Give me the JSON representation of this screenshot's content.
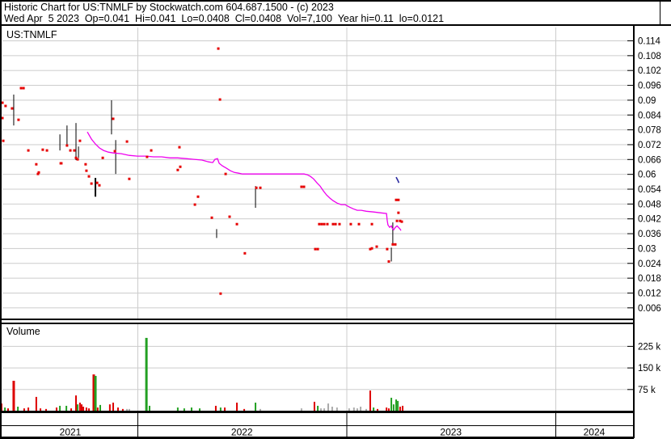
{
  "header": {
    "line1": "Historic Chart for US:TNMLF by Stockwatch.com 604.687.1500 - (c) 2023",
    "line2": "Wed Apr  5 2023  Op=0.041  Hi=0.041  Lo=0.0408  Cl=0.0408  Vol=7,100  Year hi=0.11  lo=0.0121"
  },
  "price_pane": {
    "title": "US:TNMLF"
  },
  "volume_pane": {
    "title": "Volume"
  },
  "colors": {
    "ma": "#ee00ee",
    "dot": "#e60000",
    "range_bar": "#000000",
    "vol_up": "#22a022",
    "vol_down": "#dd0000",
    "vol_flat": "#aaaaaa",
    "grid": "#cccccc",
    "marker": "#2a2aa0",
    "border": "#000000",
    "text": "#000000"
  },
  "chart_data": {
    "type": "line",
    "subtype": "stock-history-with-volume",
    "symbol": "US:TNMLF",
    "x_axis": {
      "years": [
        {
          "label": "2021",
          "start": 2021.358,
          "end": 2022.0
        },
        {
          "label": "2022",
          "start": 2022.0,
          "end": 2023.0
        },
        {
          "label": "2023",
          "start": 2023.0,
          "end": 2024.0
        },
        {
          "label": "2024",
          "start": 2024.0,
          "end": 2024.371
        }
      ],
      "t_min": 2021.358,
      "t_max": 2024.371,
      "year_boundaries": [
        2022,
        2023,
        2024
      ],
      "grid": true
    },
    "price_axis": {
      "tick_labels": [
        "0.114",
        "0.108",
        "0.102",
        "0.096",
        "0.09",
        "0.084",
        "0.078",
        "0.072",
        "0.066",
        "0.06",
        "0.054",
        "0.048",
        "0.042",
        "0.036",
        "0.03",
        "0.024",
        "0.018",
        "0.012",
        "0.006"
      ],
      "min": 0.006,
      "max": 0.114,
      "step": 0.006,
      "grid": true,
      "side": "right"
    },
    "volume_axis": {
      "ticks": [
        {
          "label": "225 k",
          "value": 225000
        },
        {
          "label": "150 k",
          "value": 150000
        },
        {
          "label": "75 k",
          "value": 75000
        }
      ],
      "grid": true,
      "side": "right"
    },
    "ma_line": {
      "name": "moving-average",
      "points": [
        [
          2021.76,
          0.077
        ],
        [
          2021.78,
          0.0741
        ],
        [
          2021.799,
          0.0721
        ],
        [
          2021.818,
          0.0705
        ],
        [
          2021.838,
          0.0695
        ],
        [
          2021.861,
          0.0688
        ],
        [
          2021.884,
          0.0685
        ],
        [
          2021.923,
          0.0682
        ],
        [
          2021.961,
          0.0675
        ],
        [
          2022.0,
          0.0672
        ],
        [
          2022.039,
          0.0672
        ],
        [
          2022.077,
          0.0669
        ],
        [
          2022.116,
          0.0669
        ],
        [
          2022.155,
          0.0665
        ],
        [
          2022.193,
          0.0665
        ],
        [
          2022.232,
          0.0662
        ],
        [
          2022.271,
          0.0659
        ],
        [
          2022.309,
          0.0656
        ],
        [
          2022.34,
          0.0649
        ],
        [
          2022.36,
          0.0646
        ],
        [
          2022.371,
          0.0659
        ],
        [
          2022.383,
          0.0662
        ],
        [
          2022.391,
          0.0643
        ],
        [
          2022.406,
          0.0633
        ],
        [
          2022.426,
          0.0623
        ],
        [
          2022.445,
          0.0613
        ],
        [
          2022.464,
          0.0606
        ],
        [
          2022.484,
          0.0603
        ],
        [
          2022.503,
          0.06
        ],
        [
          2022.797,
          0.06
        ],
        [
          2022.812,
          0.0597
        ],
        [
          2022.828,
          0.059
        ],
        [
          2022.843,
          0.058
        ],
        [
          2022.859,
          0.0564
        ],
        [
          2022.874,
          0.0551
        ],
        [
          2022.89,
          0.0531
        ],
        [
          2022.905,
          0.0515
        ],
        [
          2022.921,
          0.0502
        ],
        [
          2022.936,
          0.0492
        ],
        [
          2022.955,
          0.0482
        ],
        [
          2022.975,
          0.0476
        ],
        [
          2022.994,
          0.0476
        ],
        [
          2023.014,
          0.0466
        ],
        [
          2023.033,
          0.0459
        ],
        [
          2023.052,
          0.0453
        ],
        [
          2023.071,
          0.0453
        ],
        [
          2023.095,
          0.0449
        ],
        [
          2023.13,
          0.0446
        ],
        [
          2023.161,
          0.0443
        ],
        [
          2023.192,
          0.044
        ],
        [
          2023.195,
          0.0413
        ],
        [
          2023.199,
          0.0394
        ],
        [
          2023.207,
          0.0384
        ],
        [
          2023.215,
          0.039
        ],
        [
          2023.219,
          0.0381
        ],
        [
          2023.226,
          0.0374
        ],
        [
          2023.234,
          0.0384
        ],
        [
          2023.242,
          0.039
        ],
        [
          2023.249,
          0.0384
        ],
        [
          2023.257,
          0.0377
        ],
        [
          2023.261,
          0.0371
        ]
      ]
    },
    "trade_dots": {
      "name": "trade-price-dots",
      "points": [
        [
          2021.354,
          0.0888
        ],
        [
          2021.354,
          0.0826
        ],
        [
          2021.358,
          0.0734
        ],
        [
          2021.369,
          0.0875
        ],
        [
          2021.4,
          0.0865
        ],
        [
          2021.431,
          0.0819
        ],
        [
          2021.443,
          0.0947
        ],
        [
          2021.455,
          0.0947
        ],
        [
          2021.478,
          0.0695
        ],
        [
          2021.516,
          0.0639
        ],
        [
          2021.524,
          0.06
        ],
        [
          2021.528,
          0.0606
        ],
        [
          2021.547,
          0.0698
        ],
        [
          2021.567,
          0.0695
        ],
        [
          2021.633,
          0.0643
        ],
        [
          2021.636,
          0.0643
        ],
        [
          2021.663,
          0.0715
        ],
        [
          2021.679,
          0.0695
        ],
        [
          2021.698,
          0.0695
        ],
        [
          2021.706,
          0.0665
        ],
        [
          2021.714,
          0.0659
        ],
        [
          2021.725,
          0.0734
        ],
        [
          2021.752,
          0.0639
        ],
        [
          2021.756,
          0.0613
        ],
        [
          2021.768,
          0.059
        ],
        [
          2021.78,
          0.0561
        ],
        [
          2021.807,
          0.0564
        ],
        [
          2021.818,
          0.0554
        ],
        [
          2021.834,
          0.0665
        ],
        [
          2021.884,
          0.0823
        ],
        [
          2021.892,
          0.0692
        ],
        [
          2021.95,
          0.0731
        ],
        [
          2021.961,
          0.058
        ],
        [
          2022.046,
          0.0669
        ],
        [
          2022.066,
          0.0695
        ],
        [
          2022.193,
          0.0616
        ],
        [
          2022.201,
          0.0708
        ],
        [
          2022.205,
          0.0629
        ],
        [
          2022.275,
          0.0476
        ],
        [
          2022.29,
          0.0508
        ],
        [
          2022.356,
          0.0423
        ],
        [
          2022.387,
          0.1107
        ],
        [
          2022.395,
          0.0901
        ],
        [
          2022.398,
          0.0116
        ],
        [
          2022.422,
          0.06
        ],
        [
          2022.441,
          0.0427
        ],
        [
          2022.476,
          0.0397
        ],
        [
          2022.514,
          0.0279
        ],
        [
          2022.569,
          0.0544
        ],
        [
          2022.588,
          0.0544
        ],
        [
          2022.785,
          0.0548
        ],
        [
          2022.797,
          0.0548
        ],
        [
          2022.851,
          0.0296
        ],
        [
          2022.863,
          0.0296
        ],
        [
          2022.87,
          0.0397
        ],
        [
          2022.882,
          0.0397
        ],
        [
          2022.894,
          0.0397
        ],
        [
          2022.909,
          0.0397
        ],
        [
          2022.936,
          0.0397
        ],
        [
          2022.948,
          0.0397
        ],
        [
          2022.967,
          0.0397
        ],
        [
          2023.021,
          0.0397
        ],
        [
          2023.06,
          0.0397
        ],
        [
          2023.114,
          0.0296
        ],
        [
          2023.122,
          0.0397
        ],
        [
          2023.122,
          0.0299
        ],
        [
          2023.145,
          0.0306
        ],
        [
          2023.195,
          0.0296
        ],
        [
          2023.203,
          0.0246
        ],
        [
          2023.222,
          0.0315
        ],
        [
          2023.234,
          0.0315
        ],
        [
          2023.238,
          0.0495
        ],
        [
          2023.249,
          0.0495
        ],
        [
          2023.249,
          0.0443
        ],
        [
          2023.242,
          0.041
        ],
        [
          2023.257,
          0.041
        ],
        [
          2023.265,
          0.0407
        ]
      ]
    },
    "range_bars": {
      "name": "high-low-range-bars",
      "bars": [
        [
          2021.346,
          0.0836,
          0.0806,
          1
        ],
        [
          2021.408,
          0.0921,
          0.0796,
          1
        ],
        [
          2021.629,
          0.076,
          0.0695,
          1
        ],
        [
          2021.663,
          0.0796,
          0.0715,
          1
        ],
        [
          2021.706,
          0.0806,
          0.0656,
          1
        ],
        [
          2021.718,
          0.0711,
          0.0665,
          1
        ],
        [
          2021.799,
          0.0584,
          0.0508,
          2
        ],
        [
          2021.876,
          0.0898,
          0.076,
          1
        ],
        [
          2021.896,
          0.0737,
          0.06,
          1
        ],
        [
          2022.379,
          0.0377,
          0.0341,
          1
        ],
        [
          2022.565,
          0.0551,
          0.0463,
          1
        ],
        [
          2023.215,
          0.0302,
          0.0246,
          1
        ],
        [
          2023.222,
          0.0404,
          0.0315,
          1
        ]
      ]
    },
    "last_marker": {
      "name": "last-trade-marker",
      "points": [
        [
          2023.238,
          0.0587
        ],
        [
          2023.246,
          0.0574
        ],
        [
          2023.251,
          0.0564
        ]
      ]
    },
    "volume_bars": {
      "name": "daily-volume-bars",
      "bars": [
        [
          2021.35,
          25000,
          "r"
        ],
        [
          2021.366,
          11000,
          "g"
        ],
        [
          2021.381,
          8000,
          "r"
        ],
        [
          2021.408,
          104000,
          "r"
        ],
        [
          2021.428,
          14000,
          "g"
        ],
        [
          2021.458,
          8000,
          "r"
        ],
        [
          2021.478,
          11000,
          "r"
        ],
        [
          2021.516,
          48000,
          "r"
        ],
        [
          2021.536,
          8000,
          "r"
        ],
        [
          2021.563,
          6000,
          "r"
        ],
        [
          2021.613,
          11000,
          "r"
        ],
        [
          2021.629,
          17000,
          "g"
        ],
        [
          2021.66,
          17000,
          "g"
        ],
        [
          2021.683,
          8000,
          "r"
        ],
        [
          2021.706,
          53000,
          "r"
        ],
        [
          2021.714,
          22000,
          "g"
        ],
        [
          2021.725,
          28000,
          "r"
        ],
        [
          2021.733,
          22000,
          "r"
        ],
        [
          2021.741,
          14000,
          "r"
        ],
        [
          2021.756,
          11000,
          "r"
        ],
        [
          2021.768,
          8000,
          "r"
        ],
        [
          2021.791,
          126000,
          "r"
        ],
        [
          2021.799,
          121000,
          "g"
        ],
        [
          2021.81,
          11000,
          "r"
        ],
        [
          2021.822,
          20000,
          "g"
        ],
        [
          2021.868,
          22000,
          "r"
        ],
        [
          2021.884,
          28000,
          "r"
        ],
        [
          2021.907,
          11000,
          "r"
        ],
        [
          2021.93,
          6000,
          "r"
        ],
        [
          2021.95,
          6000,
          "a"
        ],
        [
          2021.961,
          6000,
          "a"
        ],
        [
          2022.043,
          253000,
          "g"
        ],
        [
          2022.058,
          17000,
          "g"
        ],
        [
          2022.193,
          11000,
          "g"
        ],
        [
          2022.224,
          8000,
          "g"
        ],
        [
          2022.259,
          11000,
          "g"
        ],
        [
          2022.298,
          8000,
          "g"
        ],
        [
          2022.375,
          17000,
          "r"
        ],
        [
          2022.398,
          11000,
          "g"
        ],
        [
          2022.418,
          11000,
          "r"
        ],
        [
          2022.476,
          28000,
          "r"
        ],
        [
          2022.511,
          6000,
          "r"
        ],
        [
          2022.565,
          28000,
          "g"
        ],
        [
          2022.588,
          6000,
          "a"
        ],
        [
          2022.785,
          8000,
          "a"
        ],
        [
          2022.847,
          31000,
          "r"
        ],
        [
          2022.863,
          17000,
          "g"
        ],
        [
          2022.878,
          8000,
          "a"
        ],
        [
          2022.894,
          8000,
          "a"
        ],
        [
          2022.913,
          25000,
          "a"
        ],
        [
          2022.932,
          14000,
          "a"
        ],
        [
          2022.955,
          11000,
          "a"
        ],
        [
          2023.013,
          8000,
          "a"
        ],
        [
          2023.036,
          11000,
          "a"
        ],
        [
          2023.052,
          8000,
          "a"
        ],
        [
          2023.068,
          14000,
          "a"
        ],
        [
          2023.095,
          6000,
          "a"
        ],
        [
          2023.114,
          70000,
          "r"
        ],
        [
          2023.13,
          11000,
          "g"
        ],
        [
          2023.149,
          6000,
          "r"
        ],
        [
          2023.192,
          11000,
          "r"
        ],
        [
          2023.203,
          8000,
          "r"
        ],
        [
          2023.215,
          45000,
          "g"
        ],
        [
          2023.226,
          22000,
          "g"
        ],
        [
          2023.238,
          39000,
          "g"
        ],
        [
          2023.246,
          34000,
          "g"
        ],
        [
          2023.257,
          14000,
          "r"
        ],
        [
          2023.269,
          17000,
          "r"
        ]
      ],
      "volume_full_scale": 75000
    }
  }
}
